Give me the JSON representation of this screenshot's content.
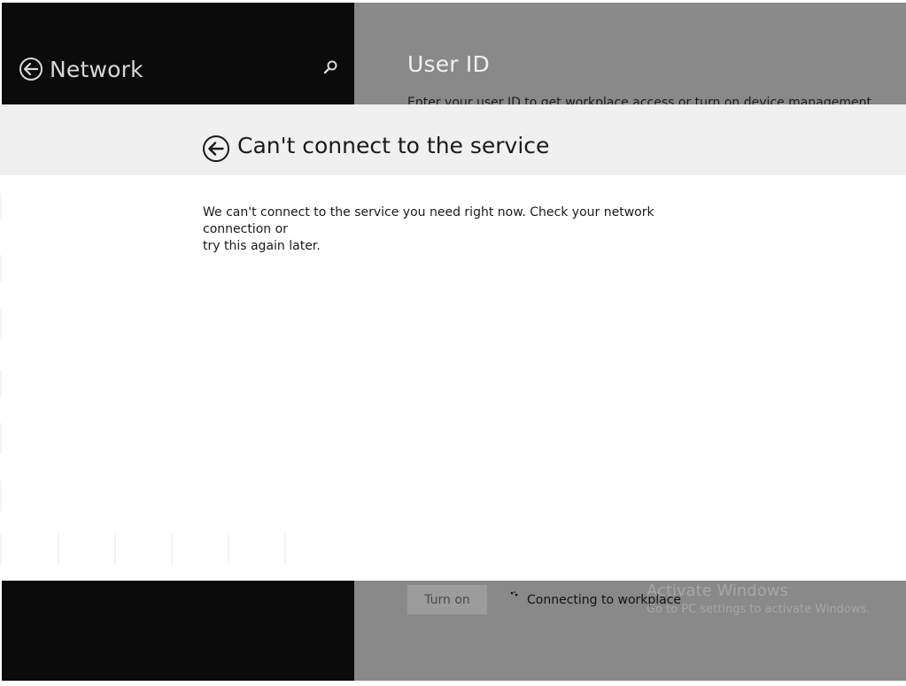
{
  "left_pane": {
    "title": "Network",
    "back_icon": "back-arrow-icon",
    "search_icon": "search-icon"
  },
  "right_pane": {
    "title": "User ID",
    "description": "Enter your user ID to get workplace access or turn on device management.",
    "turn_on_label": "Turn on",
    "status_text": "Connecting to workplace"
  },
  "watermark": {
    "title": "Activate Windows",
    "subtitle": "Go to PC settings to activate Windows."
  },
  "dialog": {
    "title": "Can't connect to the service",
    "message_line1": "We can't connect to the service you need right now. Check your network connection or",
    "message_line2": "try this again later.",
    "back_icon": "back-arrow-icon"
  },
  "colors": {
    "left_pane_bg": "#0b0b0b",
    "right_pane_bg": "#898989",
    "dialog_bg": "#ffffff",
    "dialog_header_bg": "#f0f0f0",
    "text_dark": "#1a1a1a"
  }
}
